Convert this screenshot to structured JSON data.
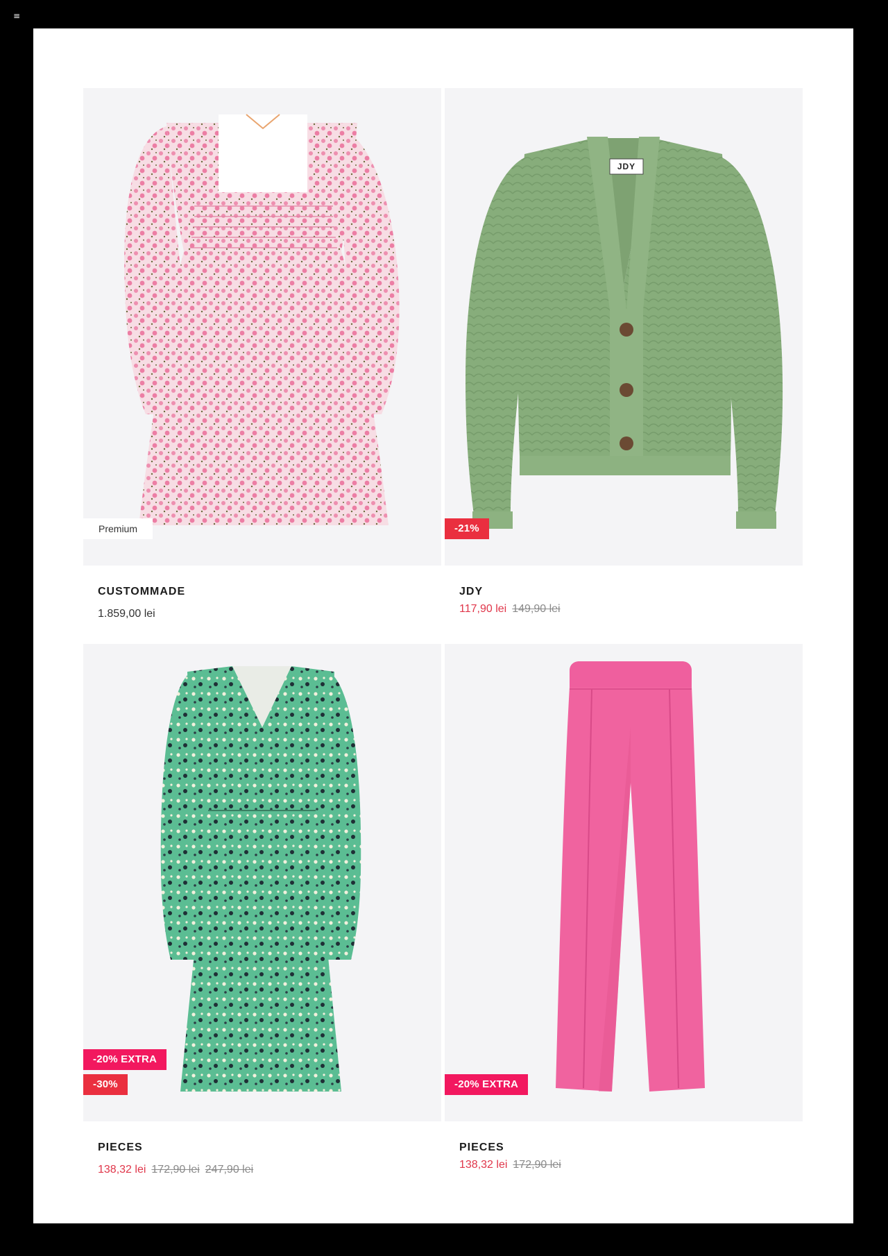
{
  "window": {
    "menu_glyph": "≡"
  },
  "products": [
    {
      "brand": "CUSTOMMADE",
      "badge": "Premium",
      "price": "1.859,00 lei",
      "image": "floral-pink-dress-icon"
    },
    {
      "brand": "JDY",
      "badge": "-21%",
      "label_tag": "JDY",
      "sale_price": "117,90 lei",
      "old_price": "149,90 lei",
      "image": "green-knit-cardigan-icon"
    },
    {
      "brand": "PIECES",
      "badges": [
        "-20% EXTRA",
        "-30%"
      ],
      "sale_price": "138,32 lei",
      "old_prices": [
        "172,90 lei",
        "247,90 lei"
      ],
      "image": "green-floral-dress-icon"
    },
    {
      "brand": "PIECES",
      "badge": "-20% EXTRA",
      "sale_price": "138,32 lei",
      "old_price": "172,90 lei",
      "image": "pink-trousers-icon"
    }
  ],
  "colors": {
    "sale": "#e0364a",
    "badge_red": "#ea2f3f",
    "badge_pink": "#f2185f",
    "tile_bg": "#f4f4f6"
  }
}
